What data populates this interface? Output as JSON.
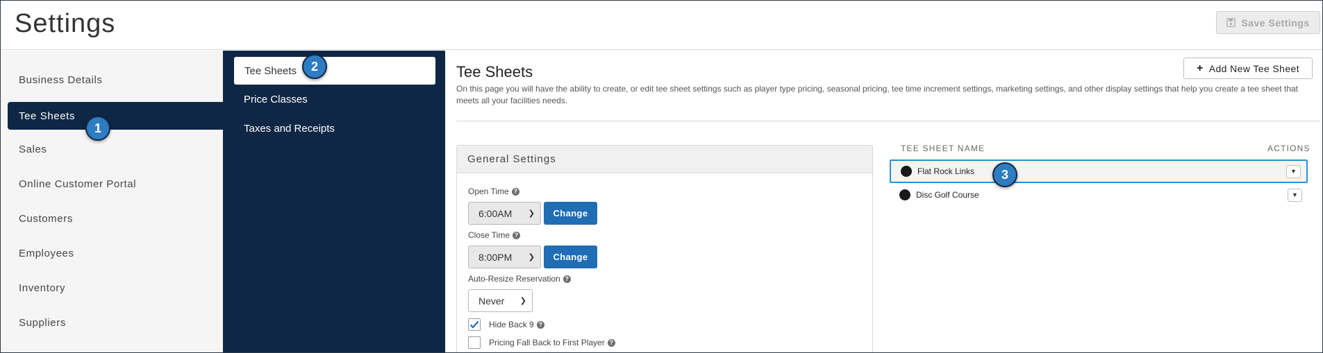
{
  "header": {
    "title": "Settings",
    "save_label": "Save Settings",
    "save_icon": "floppy-disk-icon"
  },
  "sidebar": {
    "items": [
      {
        "label": "Business Details",
        "active": false
      },
      {
        "label": "Tee Sheets",
        "active": true
      },
      {
        "label": "Sales",
        "active": false
      },
      {
        "label": "Online Customer Portal",
        "active": false
      },
      {
        "label": "Customers",
        "active": false
      },
      {
        "label": "Employees",
        "active": false
      },
      {
        "label": "Inventory",
        "active": false
      },
      {
        "label": "Suppliers",
        "active": false
      }
    ]
  },
  "subnav": {
    "items": [
      {
        "label": "Tee Sheets",
        "active": true
      },
      {
        "label": "Price Classes",
        "active": false
      },
      {
        "label": "Taxes and Receipts",
        "active": false
      }
    ]
  },
  "badges": [
    "1",
    "2",
    "3"
  ],
  "main": {
    "title": "Tee Sheets",
    "description": "On this page you will have the ability to create, or edit tee sheet settings such as player type pricing, seasonal pricing, tee time increment settings, marketing settings, and other display settings that help you create a tee sheet that meets all your facilities needs.",
    "add_label": "Add New Tee Sheet",
    "general": {
      "heading": "General Settings",
      "open_time_label": "Open Time",
      "open_time_value": "6:00AM",
      "close_time_label": "Close Time",
      "close_time_value": "8:00PM",
      "change_label": "Change",
      "auto_resize_label": "Auto-Resize Reservation",
      "auto_resize_value": "Never",
      "hide_back9_label": "Hide Back 9",
      "hide_back9_checked": true,
      "pricing_fallback_label": "Pricing Fall Back to First Player",
      "pricing_fallback_checked": false
    },
    "list": {
      "col_name": "TEE SHEET NAME",
      "col_actions": "ACTIONS",
      "rows": [
        {
          "name": "Flat Rock Links",
          "highlighted": true
        },
        {
          "name": "Disc Golf Course",
          "highlighted": false
        }
      ]
    }
  },
  "colors": {
    "navy": "#0f2744",
    "accent_blue": "#1e6db5",
    "badge_blue": "#2e7cc2",
    "highlight_border": "#2e8fd1"
  }
}
